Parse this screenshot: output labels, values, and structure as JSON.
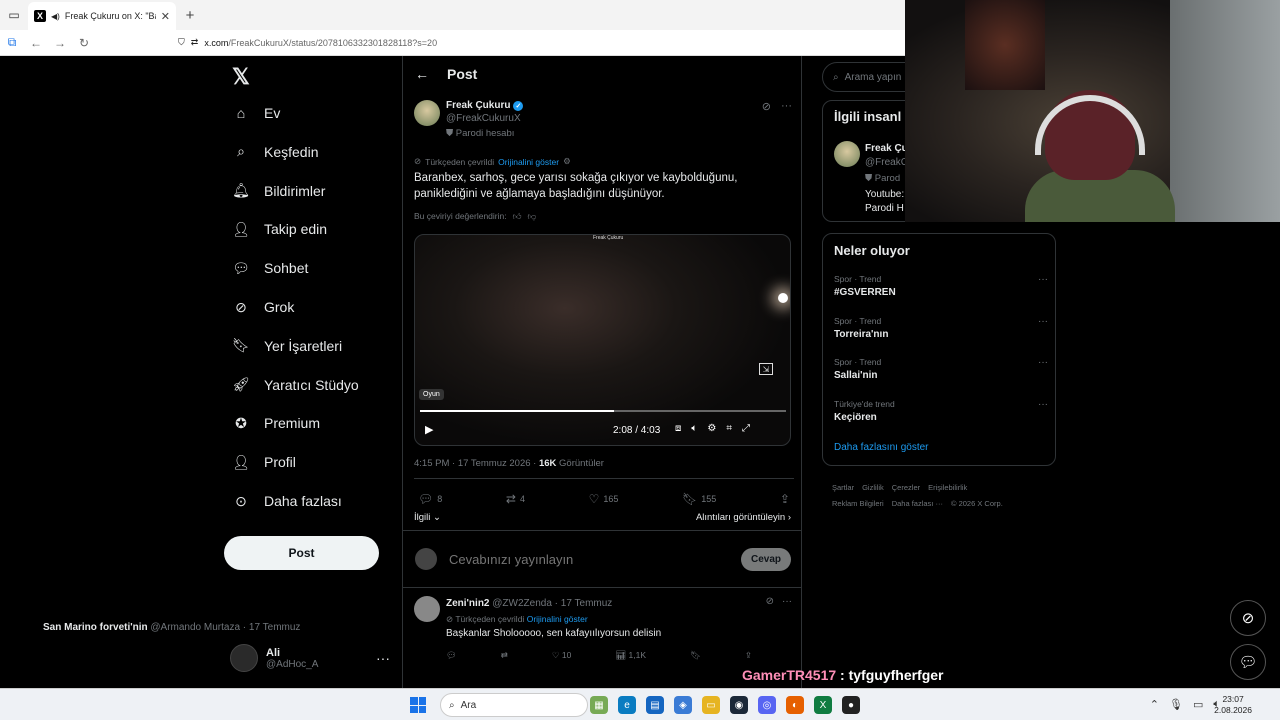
{
  "browser": {
    "tab_title": "Freak Çukuru on X: \"Baranb",
    "url_host": "x.com",
    "url_path": "/FreakCukuruX/status/2078106332301828118?s=20"
  },
  "nav": {
    "items": [
      {
        "label": "Ev",
        "icon": "home-icon"
      },
      {
        "label": "Keşfedin",
        "icon": "search-icon"
      },
      {
        "label": "Bildirimler",
        "icon": "bell-icon"
      },
      {
        "label": "Takip edin",
        "icon": "follow-icon"
      },
      {
        "label": "Sohbet",
        "icon": "chat-icon"
      },
      {
        "label": "Grok",
        "icon": "grok-icon"
      },
      {
        "label": "Yer İşaretleri",
        "icon": "bookmark-icon"
      },
      {
        "label": "Yaratıcı Stüdyo",
        "icon": "rocket-icon"
      },
      {
        "label": "Premium",
        "icon": "premium-icon"
      },
      {
        "label": "Profil",
        "icon": "person-icon"
      },
      {
        "label": "Daha fazlası",
        "icon": "more-icon"
      }
    ],
    "post_button": "Post",
    "account_name": "Ali",
    "account_handle": "@AdHoc_A"
  },
  "post": {
    "header": "Post",
    "author_name": "Freak Çukuru",
    "author_handle": "@FreakCukuruX",
    "parody_label": "Parodi hesabı",
    "translated_from": "Türkçeden çevrildi",
    "show_original": "Orijinalini göster",
    "text": "Baranbex, sarhoş, gece yarısı sokağa çıkıyor ve kaybolduğunu, paniklediğini ve ağlamaya başladığını düşünüyor.",
    "rate_translation": "Bu çeviriyi değerlendirin:",
    "video": {
      "logo": "Freak Çukuru",
      "badge": "Oyun",
      "time": "2:08 / 4:03",
      "progress": 0.53
    },
    "timestamp": "4:15 PM · 17 Temmuz 2026 · ",
    "views_count": "16K",
    "views_label": "Görüntüler",
    "replies": "8",
    "reposts": "4",
    "likes": "165",
    "bookmarks": "155",
    "relevant": "İlgili",
    "view_quotes": "Alıntıları görüntüleyin",
    "reply_placeholder": "Cevabınızı yayınlayın",
    "reply_button": "Cevap"
  },
  "replies": [
    {
      "name": "Zeni'nin2",
      "handle": "@ZW2Zenda · 17 Temmuz",
      "translated": "Türkçeden çevrildi",
      "show_original": "Orijinalini göster",
      "text": "Başkanlar Sholooooo, sen kafayıılıyorsun delisin",
      "likes": "10",
      "views": "1,1K"
    },
    {
      "name": "San Marino forveti'nin",
      "handle": "@Armando Murtaza · 17 Temmuz"
    }
  ],
  "sidebar": {
    "search_placeholder": "Arama yapın",
    "relevant_title": "İlgili insanl",
    "rel_name": "Freak Çu",
    "rel_handle": "@FreakC",
    "rel_parody": "Parod",
    "rel_bio1": "Youtube:",
    "rel_bio2": "Parodi H",
    "trends_title": "Neler oluyor",
    "trends": [
      {
        "category": "Spor · Trend",
        "name": "#GSVERREN"
      },
      {
        "category": "Spor · Trend",
        "name": "Torreira'nın"
      },
      {
        "category": "Spor · Trend",
        "name": "Sallai'nin"
      },
      {
        "category": "Türkiye'de trend",
        "name": "Keçiören"
      }
    ],
    "show_more": "Daha fazlasını göster",
    "footer_line1": [
      "Şartlar",
      "Gizlilik",
      "Çerezler",
      "Erişilebilirlik"
    ],
    "footer_line2": [
      "Reklam Bilgileri",
      "Daha fazlası ···",
      "© 2026 X Corp."
    ]
  },
  "overlay": {
    "chat_user": "GamerTR4517",
    "chat_text": " : tyfguyfherfger"
  },
  "taskbar": {
    "search": "Ara",
    "time": "23:07",
    "date": "2.08.2026"
  }
}
